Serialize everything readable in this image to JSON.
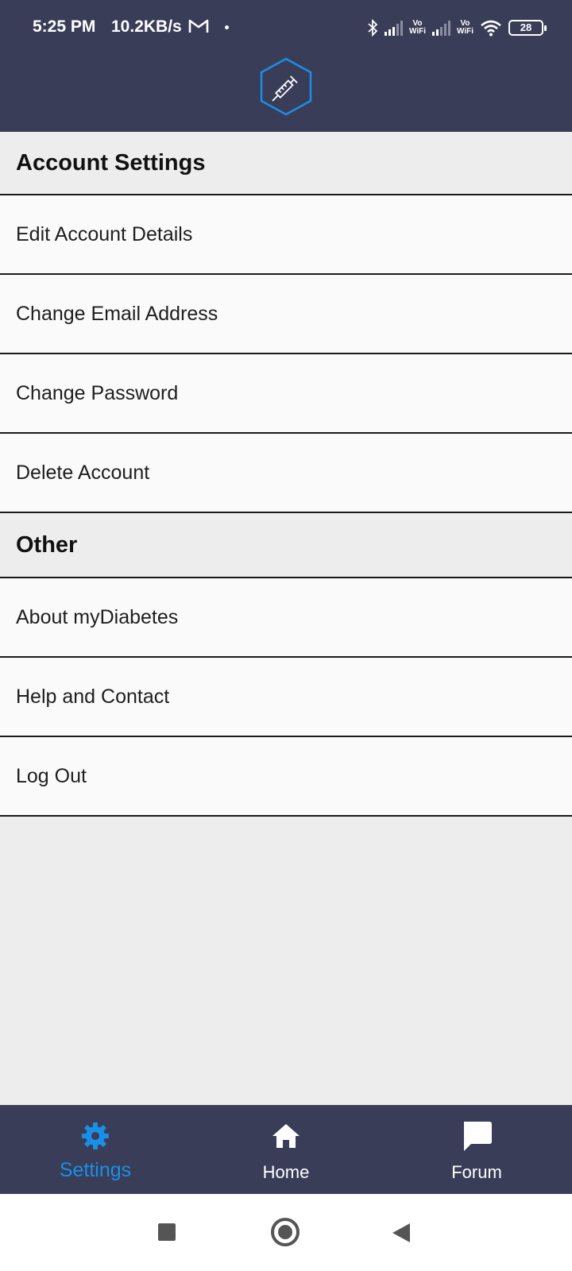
{
  "status_bar": {
    "time": "5:25 PM",
    "speed": "10.2KB/s",
    "vowifi_label_1": "Vo\nWiFi",
    "vowifi_label_2": "Vo\nWiFi",
    "battery": "28"
  },
  "header": {
    "logo_icon": "syringe-hexagon-icon"
  },
  "sections": [
    {
      "title": "Account Settings",
      "items": [
        "Edit Account Details",
        "Change Email Address",
        "Change Password",
        "Delete Account"
      ]
    },
    {
      "title": "Other",
      "items": [
        "About myDiabetes",
        "Help and Contact",
        "Log Out"
      ]
    }
  ],
  "bottom_nav": {
    "tabs": [
      {
        "label": "Settings",
        "icon": "gear-icon",
        "active": true
      },
      {
        "label": "Home",
        "icon": "home-icon",
        "active": false
      },
      {
        "label": "Forum",
        "icon": "chat-icon",
        "active": false
      }
    ]
  },
  "colors": {
    "header_bg": "#393d58",
    "accent": "#1a8fe8",
    "list_bg": "#fafafa",
    "section_bg": "#ededed"
  }
}
